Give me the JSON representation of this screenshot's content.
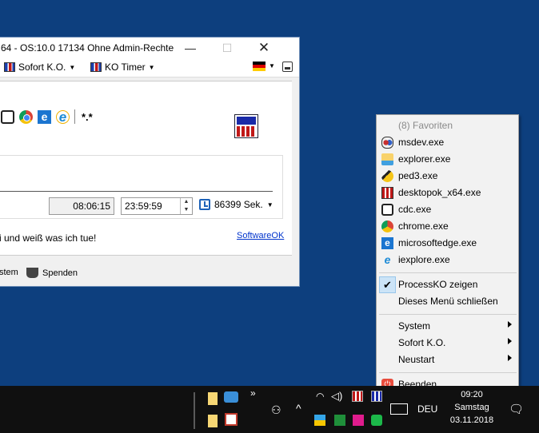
{
  "window": {
    "title": "64  -  OS:10.0 17134 Ohne Admin-Rechte",
    "minimize_glyph": "—",
    "maximize_glyph": "☐",
    "close_glyph": "✕"
  },
  "menubar": {
    "items": [
      {
        "label": "Sofort K.O.",
        "icon": "ko-icon"
      },
      {
        "label": "KO Timer",
        "icon": "ko-icon"
      }
    ],
    "caret": "▼"
  },
  "toolbar": {
    "wildcard": "*.*",
    "icons": [
      "cdc-icon",
      "chrome-icon",
      "edge-icon",
      "ie-icon"
    ]
  },
  "timer": {
    "current_time": "08:06:15",
    "target_time": "23:59:59",
    "seconds_label": "86399 Sek.",
    "spin_up": "▲",
    "spin_down": "▼"
  },
  "status": {
    "message": "i und weiß was ich tue!",
    "link": "SoftwareOK"
  },
  "bottombar": {
    "system_label": "stem",
    "donate_label": "Spenden"
  },
  "context_menu": {
    "favorites_header": "(8) Favoriten",
    "favorites": [
      {
        "label": "msdev.exe",
        "icon": "msdev-icon"
      },
      {
        "label": "explorer.exe",
        "icon": "explorer-icon"
      },
      {
        "label": "ped3.exe",
        "icon": "ped3-icon"
      },
      {
        "label": "desktopok_x64.exe",
        "icon": "desktopok-icon"
      },
      {
        "label": "cdc.exe",
        "icon": "cdc-icon"
      },
      {
        "label": "chrome.exe",
        "icon": "chrome-icon"
      },
      {
        "label": "microsoftedge.exe",
        "icon": "edge-icon"
      },
      {
        "label": "iexplore.exe",
        "icon": "ie-icon"
      }
    ],
    "show_processko": "ProcessKO zeigen",
    "close_menu": "Dieses Menü schließen",
    "submenus": [
      "System",
      "Sofort K.O.",
      "Neustart"
    ],
    "quit": "Beenden",
    "check_glyph": "✔"
  },
  "taskbar": {
    "overflow": "»",
    "language": "DEU",
    "time": "09:20",
    "day": "Samstag",
    "date": "03.11.2018",
    "notification_glyph": "🗨"
  },
  "colors": {
    "desktop": "#0d3f7e",
    "taskbar": "#101010",
    "menu_bg": "#f2f2f2",
    "check_highlight": "#cce4f7",
    "link": "#0033cc"
  }
}
